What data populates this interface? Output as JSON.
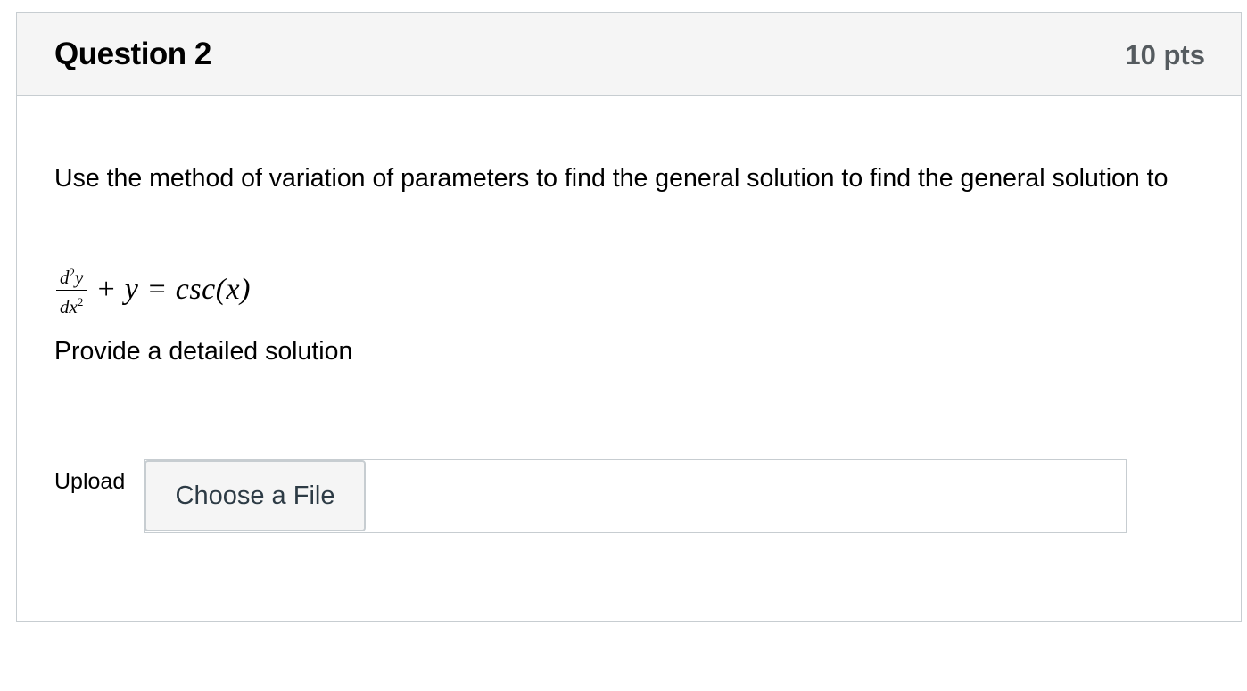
{
  "question": {
    "title": "Question 2",
    "points": "10 pts",
    "text": "Use the method of variation of parameters to find the general solution to find the general solution to",
    "equation": {
      "numerator_d": "d",
      "numerator_exp": "2",
      "numerator_var": "y",
      "denominator_d": "dx",
      "denominator_exp": "2",
      "rest": "+ y = csc(x)"
    },
    "instruction": "Provide a detailed solution"
  },
  "upload": {
    "label": "Upload",
    "button_label": "Choose a File"
  }
}
